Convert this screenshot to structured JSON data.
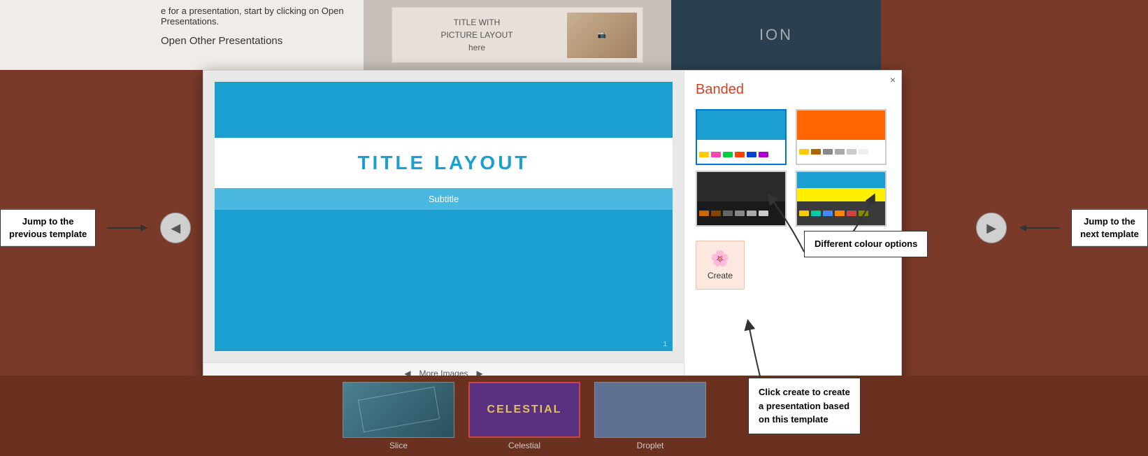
{
  "background": {
    "color": "#7a3a2a"
  },
  "bg_top_left": {
    "line1": "e for a presentation, start by clicking on Open",
    "line2": "Presentations."
  },
  "bg_top_center": {
    "title": "TITLE WITH",
    "subtitle": "PICTURE LAYOUT",
    "sub2": "here"
  },
  "bg_top_right": {
    "text": "ION"
  },
  "open_other": {
    "label": "Open Other Presentations"
  },
  "nav_prev": {
    "label": "Jump to the\nprevious template",
    "arrow": "◀"
  },
  "nav_next": {
    "label": "Jump to the\nnext template",
    "arrow": "▶"
  },
  "dialog": {
    "close_label": "×",
    "template_name": "Banded",
    "slide": {
      "title": "TITLE LAYOUT",
      "subtitle": "Subtitle",
      "number": "1"
    },
    "more_images": "More Images",
    "swatches": [
      {
        "id": 1,
        "name": "blue-white",
        "selected": true,
        "top_color": "#1a9fd0",
        "bottom_colors": [
          "#ffcc00",
          "#ff44aa",
          "#00cc44",
          "#ff4400",
          "#0044cc",
          "#aa00cc"
        ]
      },
      {
        "id": 2,
        "name": "orange-white",
        "selected": false,
        "top_color": "#ff6600",
        "bottom_colors": [
          "#ffcc00",
          "#aa6600",
          "#888888",
          "#aaaaaa",
          "#cccccc",
          "#eeeeee"
        ]
      },
      {
        "id": 3,
        "name": "dark-brown",
        "selected": false,
        "top_color": "#2a2a2a",
        "bottom_colors": [
          "#cc6600",
          "#884400",
          "#666666",
          "#888888",
          "#aaaaaa",
          "#cccccc"
        ]
      },
      {
        "id": 4,
        "name": "dark-cyan",
        "selected": false,
        "top_color": "#1a9fd0",
        "bottom_colors": [
          "#ffcc00",
          "#00ccaa",
          "#4488ff",
          "#ff8800",
          "#cc4444",
          "#888800"
        ]
      }
    ],
    "create_button": {
      "label": "Create",
      "icon": "📄"
    }
  },
  "callouts": {
    "different_colours": "Different colour\noptions",
    "click_create": "Click create to create\na presentation based\non this template"
  },
  "bottom_templates": [
    {
      "name": "Slice",
      "label": "Slice"
    },
    {
      "name": "Celestial",
      "label": "Celestial",
      "title": "CELESTIAL"
    },
    {
      "name": "Droplet",
      "label": "Droplet"
    }
  ]
}
